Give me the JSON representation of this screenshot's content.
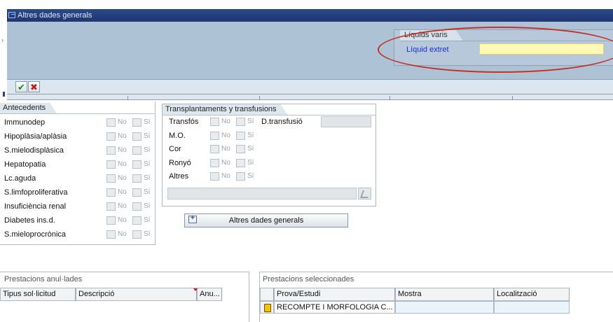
{
  "dialog": {
    "title": "Altres dades generals",
    "liquids_group": {
      "title": "Líquids varis",
      "field_label": "Líquid extret",
      "field_value": ""
    },
    "confirm_icon": "checkmark-icon",
    "cancel_icon": "cross-icon"
  },
  "antecedents": {
    "title": "Antecedents",
    "rows": [
      {
        "label": "Immunodep",
        "no": "No",
        "si": "Sí"
      },
      {
        "label": "Hipoplàsia/aplàsia",
        "no": "No",
        "si": "Sí"
      },
      {
        "label": "S.mielodisplàsica",
        "no": "No",
        "si": "Sí"
      },
      {
        "label": "Hepatopatia",
        "no": "No",
        "si": "Sí"
      },
      {
        "label": "Lc.aguda",
        "no": "No",
        "si": "Sí"
      },
      {
        "label": "S.limfoproliferativa",
        "no": "No",
        "si": "Sí"
      },
      {
        "label": "Insuficiència renal",
        "no": "No",
        "si": "Sí"
      },
      {
        "label": "Diabetes ins.d.",
        "no": "No",
        "si": "Sí"
      },
      {
        "label": "S.mieloprocrònica",
        "no": "No",
        "si": "Sí"
      }
    ]
  },
  "transplantaments": {
    "title": "Transplantaments y transfusions",
    "rows": [
      {
        "label": "Transfós",
        "no": "No",
        "si": "Sí"
      },
      {
        "label": "M.O.",
        "no": "No",
        "si": "Sí"
      },
      {
        "label": "Cor",
        "no": "No",
        "si": "Sí"
      },
      {
        "label": "Ronyó",
        "no": "No",
        "si": "Sí"
      },
      {
        "label": "Altres",
        "no": "No",
        "si": "Sí"
      }
    ],
    "transfusio_label": "D.transfusió",
    "transfusio_value": "",
    "text_value": ""
  },
  "altres_button": {
    "label": "Altres dades generals",
    "icon": "expand-icon"
  },
  "prestacions_anulades": {
    "title": "Prestacions anul·lades",
    "columns": [
      "Tipus sol·licitud",
      "Descripció",
      "Anu..."
    ]
  },
  "prestacions_seleccionades": {
    "title": "Prestacions seleccionades",
    "columns": [
      "Prova/Estudi",
      "Mostra",
      "Localització"
    ],
    "rows": [
      {
        "prova": "RECOMPTE I MORFOLOGIA C...",
        "mostra": "",
        "localitzacio": ""
      }
    ]
  },
  "colors": {
    "title_bar": "#1f3570",
    "dialog_body": "#aec2d5",
    "highlight_input": "#fff9b5",
    "annotation_ellipse": "#c3312a",
    "field_label_blue": "#1a2fc7"
  }
}
